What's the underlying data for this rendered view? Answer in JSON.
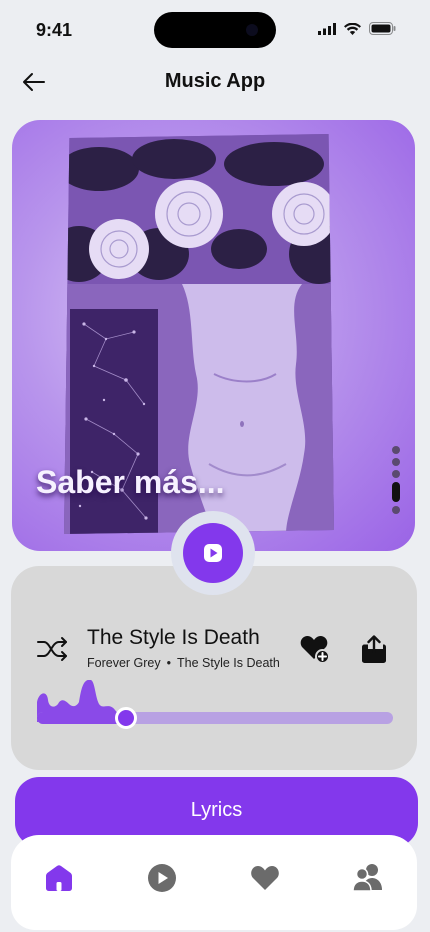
{
  "status_bar": {
    "time": "9:41"
  },
  "header": {
    "title": "Music App",
    "back_icon": "arrow-left-icon"
  },
  "artwork": {
    "cta_label": "Saber más...",
    "slides_total": 5,
    "slide_active": 4
  },
  "track": {
    "title": "The Style Is Death",
    "artist": "Forever Grey",
    "separator": "•",
    "album": "The Style Is Death",
    "progress": 0.25
  },
  "actions": {
    "lyrics_label": "Lyrics"
  },
  "tabs": [
    {
      "id": "home",
      "icon": "home-icon",
      "active": true
    },
    {
      "id": "play",
      "icon": "play-circle-icon",
      "active": false
    },
    {
      "id": "favorites",
      "icon": "heart-icon",
      "active": false
    },
    {
      "id": "friends",
      "icon": "users-icon",
      "active": false
    }
  ],
  "colors": {
    "accent": "#8338ec",
    "inactive": "#6b6b6b",
    "card": "#d8d8d8",
    "background": "#eceef2"
  }
}
